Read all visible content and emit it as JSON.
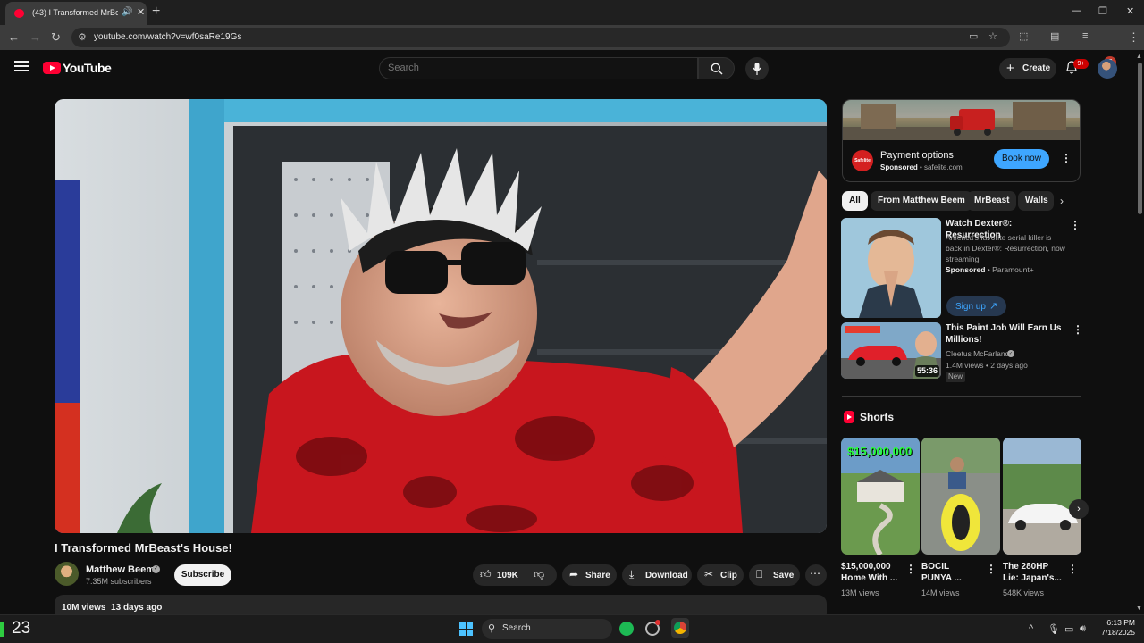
{
  "browser": {
    "tab_title": "(43) I Transformed MrBeast's House!",
    "url": "youtube.com/watch?v=wf0saRe19Gs",
    "profile_initial": "S"
  },
  "masthead": {
    "logo_text": "YouTube",
    "search_placeholder": "Search",
    "create_label": "Create",
    "notification_count": "9+"
  },
  "video": {
    "title": "I Transformed MrBeast's House!",
    "channel": "Matthew Beem",
    "subscribers": "7.35M subscribers",
    "subscribe_label": "Subscribe",
    "likes": "109K",
    "share_label": "Share",
    "download_label": "Download",
    "clip_label": "Clip",
    "save_label": "Save",
    "views": "10M views",
    "age": "13 days ago"
  },
  "ad": {
    "title": "Payment options",
    "sponsored": "Sponsored",
    "domain": "safelite.com",
    "cta": "Book now",
    "logo_text": "Safelite"
  },
  "chips": [
    "All",
    "From Matthew Beem",
    "MrBeast",
    "Walls"
  ],
  "recommendations": [
    {
      "title": "Watch Dexter®: Resurrection",
      "description": "America's favorite serial killer is back in Dexter®: Resurrection, now streaming.",
      "sponsored": "Sponsored",
      "advertiser": "Paramount+",
      "cta": "Sign up"
    },
    {
      "title": "This Paint Job Will Earn Us Millions!",
      "channel": "Cleetus McFarland",
      "views": "1.4M views",
      "age": "2 days ago",
      "badge": "New",
      "duration": "55:36"
    }
  ],
  "shorts": {
    "section_title": "Shorts",
    "items": [
      {
        "title": "$15,000,000 Home With ...",
        "views": "13M views",
        "overlay": "$15,000,000"
      },
      {
        "title": "BOCIL PUNYA ...",
        "views": "14M views"
      },
      {
        "title": "The 280HP Lie: Japan's...",
        "views": "548K views"
      }
    ]
  },
  "taskbar": {
    "weather_temp": "23",
    "search_label": "Search",
    "time": "6:13 PM",
    "date": "7/18/2025"
  },
  "colors": {
    "youtube_red": "#ff0033",
    "background": "#0f0f0f",
    "link_blue": "#3ea6ff"
  }
}
